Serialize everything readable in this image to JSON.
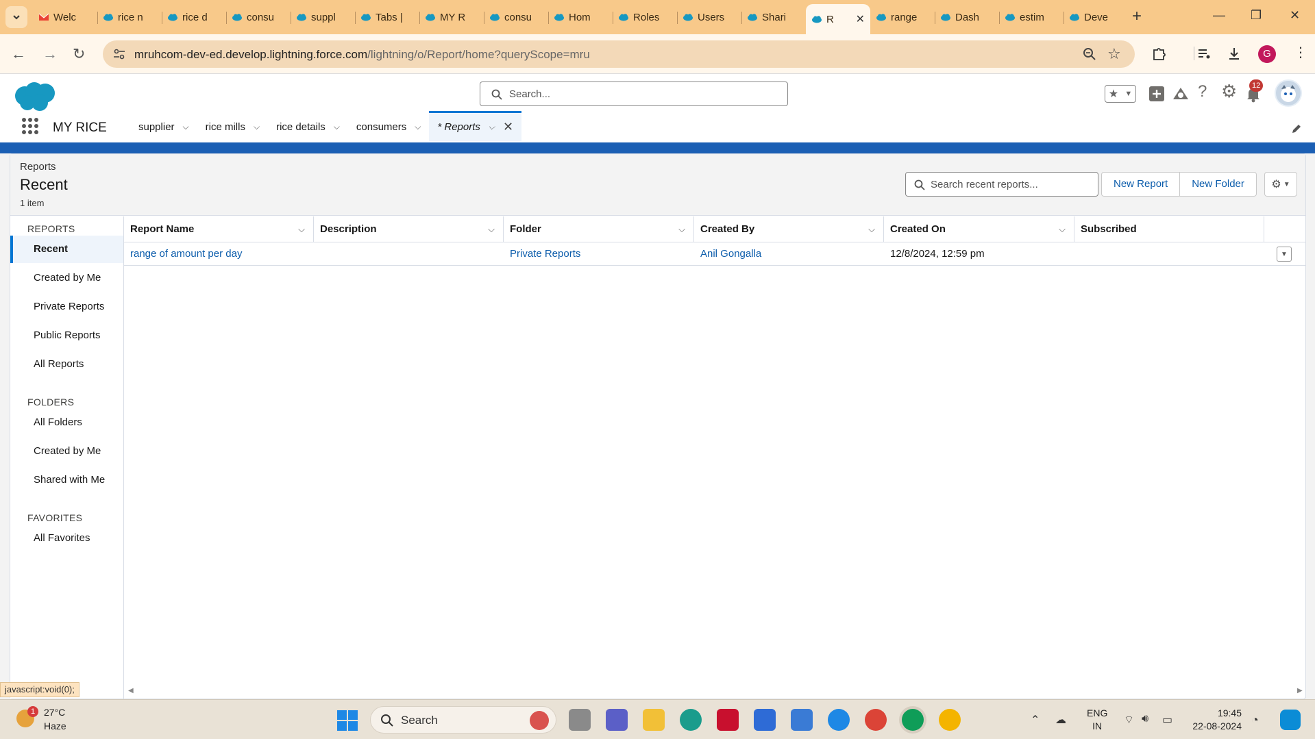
{
  "browser": {
    "tabs": [
      {
        "label": "Welc",
        "icon": "gmail-icon"
      },
      {
        "label": "rice n",
        "icon": "salesforce-icon"
      },
      {
        "label": "rice d",
        "icon": "salesforce-icon"
      },
      {
        "label": "consu",
        "icon": "salesforce-icon"
      },
      {
        "label": "suppl",
        "icon": "salesforce-icon"
      },
      {
        "label": "Tabs |",
        "icon": "salesforce-icon"
      },
      {
        "label": "MY R",
        "icon": "salesforce-icon"
      },
      {
        "label": "consu",
        "icon": "salesforce-icon"
      },
      {
        "label": "Hom",
        "icon": "salesforce-icon"
      },
      {
        "label": "Roles",
        "icon": "salesforce-icon"
      },
      {
        "label": "Users",
        "icon": "salesforce-icon"
      },
      {
        "label": "Shari",
        "icon": "salesforce-icon"
      },
      {
        "label": "R",
        "icon": "salesforce-icon",
        "active": true
      },
      {
        "label": "range",
        "icon": "salesforce-icon"
      },
      {
        "label": "Dash",
        "icon": "salesforce-icon"
      },
      {
        "label": "estim",
        "icon": "salesforce-icon"
      },
      {
        "label": "Deve",
        "icon": "salesforce-icon"
      }
    ],
    "url_host": "mruhcom-dev-ed.develop.lightning.force.com",
    "url_path": "/lightning/o/Report/home?queryScope=mru",
    "profile_initial": "G",
    "accent": "#f8c98a"
  },
  "sf": {
    "search_placeholder": "Search...",
    "notifications_count": "12",
    "app_name": "MY RICE",
    "nav": [
      {
        "label": "supplier"
      },
      {
        "label": "rice mills"
      },
      {
        "label": "rice details"
      },
      {
        "label": "consumers"
      }
    ],
    "active_tab": "* Reports",
    "brand_color": "#0176d3"
  },
  "page": {
    "breadcrumb": "Reports",
    "title": "Recent",
    "count": "1 item",
    "search_placeholder": "Search recent reports...",
    "new_report": "New Report",
    "new_folder": "New Folder"
  },
  "sidebar": {
    "reports_heading": "REPORTS",
    "reports": [
      "Recent",
      "Created by Me",
      "Private Reports",
      "Public Reports",
      "All Reports"
    ],
    "folders_heading": "FOLDERS",
    "folders": [
      "All Folders",
      "Created by Me",
      "Shared with Me"
    ],
    "favorites_heading": "FAVORITES",
    "favorites": [
      "All Favorites"
    ]
  },
  "table": {
    "columns": [
      "Report Name",
      "Description",
      "Folder",
      "Created By",
      "Created On",
      "Subscribed"
    ],
    "rows": [
      {
        "report_name": "range of amount per day",
        "description": "",
        "folder": "Private Reports",
        "created_by": "Anil Gongalla",
        "created_on": "12/8/2024, 12:59 pm",
        "subscribed": ""
      }
    ]
  },
  "status_url": "javascript:void(0);",
  "taskbar": {
    "weather_badge": "1",
    "temp": "27°C",
    "condition": "Haze",
    "search_label": "Search",
    "lang_line1": "ENG",
    "lang_line2": "IN",
    "time": "19:45",
    "date": "22-08-2024"
  }
}
